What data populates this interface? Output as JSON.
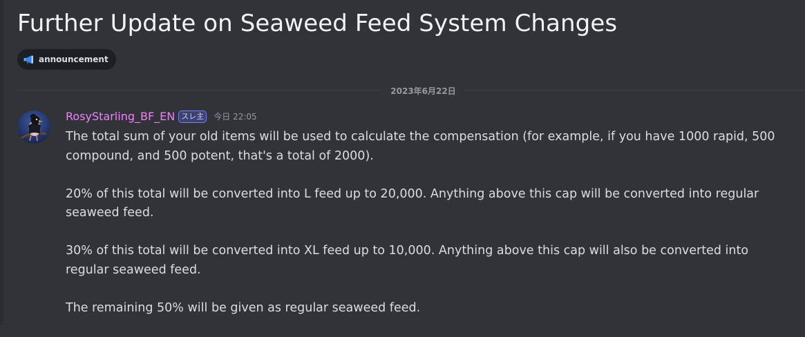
{
  "thread": {
    "title": "Further Update on Seaweed Feed System Changes",
    "tag": {
      "icon": "megaphone-icon",
      "label": "announcement"
    }
  },
  "date_divider": "2023年6月22日",
  "message": {
    "author": "RosyStarling_BF_EN",
    "author_color": "#f47fff",
    "badge": "スレ主",
    "timestamp": "今日 22:05",
    "avatar_icon": "bird-avatar-icon",
    "paragraphs": [
      "The total sum of your old items will be used to calculate the compensation (for example, if you have 1000 rapid, 500 compound, and 500 potent, that's a total of 2000).",
      "20% of this total will be converted into L feed up to 20,000. Anything above this cap will be converted into regular seaweed feed.",
      "30% of this total will be converted into XL feed up to 10,000. Anything above this cap will also be converted into regular seaweed feed.",
      "The remaining 50% will be given as regular seaweed feed."
    ]
  },
  "colors": {
    "background": "#313338",
    "text": "#dbdee1",
    "muted": "#949ba4",
    "tag_background": "#1e1f22",
    "badge_accent": "#5865f2"
  }
}
